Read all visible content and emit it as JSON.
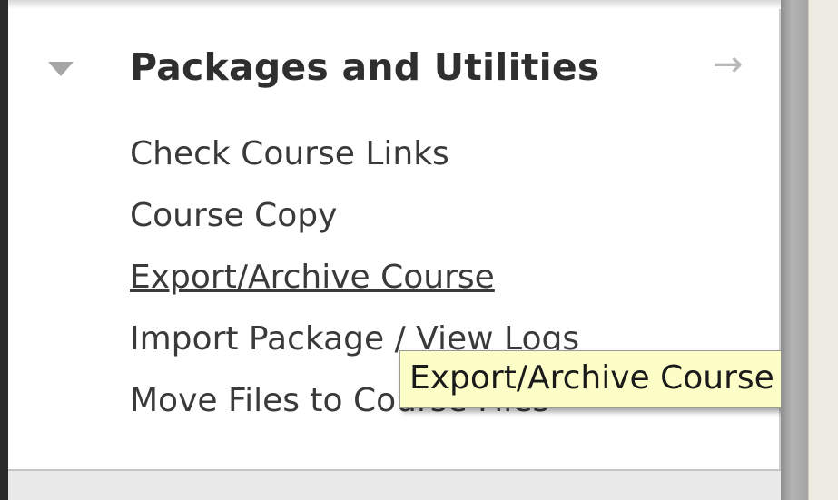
{
  "section": {
    "title": "Packages and Utilities",
    "expanded": true,
    "toggle_icon": "triangle-down-icon",
    "action_icon": "arrow-right-icon",
    "arrow_glyph": "→",
    "items": [
      {
        "label": "Check Course Links"
      },
      {
        "label": "Course Copy"
      },
      {
        "label": "Export/Archive Course",
        "hovered": true
      },
      {
        "label": "Import Package / View Logs"
      },
      {
        "label": "Move Files to Course Files"
      }
    ]
  },
  "tooltip": {
    "text": "Export/Archive Course"
  },
  "colors": {
    "panel_bg": "#ffffff",
    "text": "#3a3a3a",
    "tooltip_bg": "#fdfdc8"
  }
}
